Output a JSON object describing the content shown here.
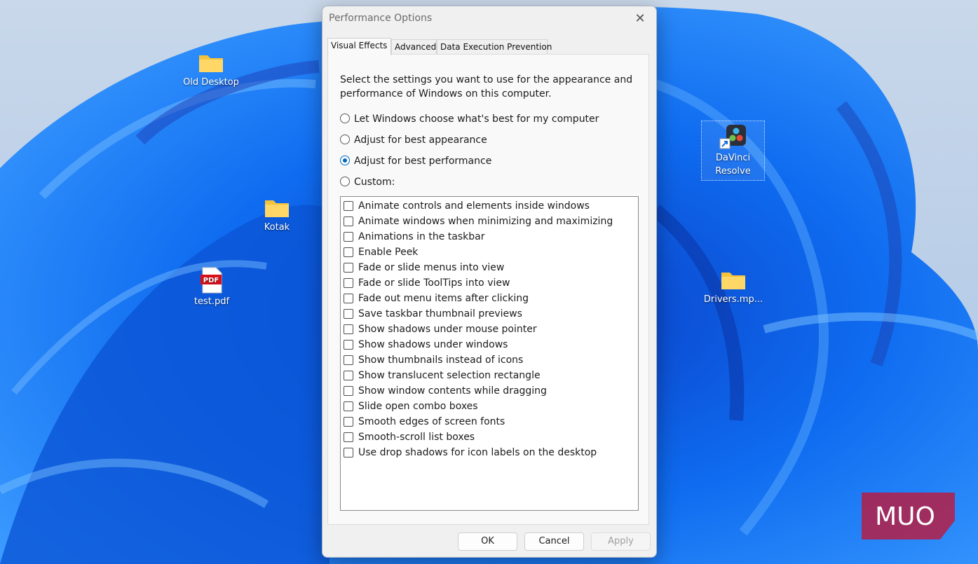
{
  "desktop": {
    "icons": [
      {
        "label": "Old Desktop",
        "icon": "folder-icon"
      },
      {
        "label": "Kotak",
        "icon": "folder-icon"
      },
      {
        "label": "test.pdf",
        "icon": "pdf-file-icon",
        "badge": "PDF"
      },
      {
        "label": "DaVinci Resolve",
        "label_line1": "DaVinci",
        "label_line2": "Resolve",
        "icon": "davinci-resolve-shortcut-icon"
      },
      {
        "label": "Drivers.mp...",
        "icon": "folder-icon"
      }
    ]
  },
  "dialog": {
    "title": "Performance Options",
    "close_glyph": "✕",
    "tabs": [
      {
        "label": "Visual Effects",
        "active": true
      },
      {
        "label": "Advanced",
        "active": false
      },
      {
        "label": "Data Execution Prevention",
        "active": false
      }
    ],
    "intro": "Select the settings you want to use for the appearance and performance of Windows on this computer.",
    "options": [
      {
        "label": "Let Windows choose what's best for my computer",
        "checked": false
      },
      {
        "label": "Adjust for best appearance",
        "checked": false
      },
      {
        "label": "Adjust for best performance",
        "checked": true
      },
      {
        "label": "Custom:",
        "checked": false
      }
    ],
    "effects": [
      {
        "label": "Animate controls and elements inside windows",
        "checked": false
      },
      {
        "label": "Animate windows when minimizing and maximizing",
        "checked": false
      },
      {
        "label": "Animations in the taskbar",
        "checked": false
      },
      {
        "label": "Enable Peek",
        "checked": false
      },
      {
        "label": "Fade or slide menus into view",
        "checked": false
      },
      {
        "label": "Fade or slide ToolTips into view",
        "checked": false
      },
      {
        "label": "Fade out menu items after clicking",
        "checked": false
      },
      {
        "label": "Save taskbar thumbnail previews",
        "checked": false
      },
      {
        "label": "Show shadows under mouse pointer",
        "checked": false
      },
      {
        "label": "Show shadows under windows",
        "checked": false
      },
      {
        "label": "Show thumbnails instead of icons",
        "checked": false
      },
      {
        "label": "Show translucent selection rectangle",
        "checked": false
      },
      {
        "label": "Show window contents while dragging",
        "checked": false
      },
      {
        "label": "Slide open combo boxes",
        "checked": false
      },
      {
        "label": "Smooth edges of screen fonts",
        "checked": false
      },
      {
        "label": "Smooth-scroll list boxes",
        "checked": false
      },
      {
        "label": "Use drop shadows for icon labels on the desktop",
        "checked": false
      }
    ],
    "buttons": {
      "ok": "OK",
      "cancel": "Cancel",
      "apply": "Apply"
    }
  },
  "watermark": {
    "text": "MUO"
  },
  "colors": {
    "accent": "#0067c0",
    "wallpaper_blue": "#0a5fe0",
    "watermark_red": "#c8102e"
  }
}
